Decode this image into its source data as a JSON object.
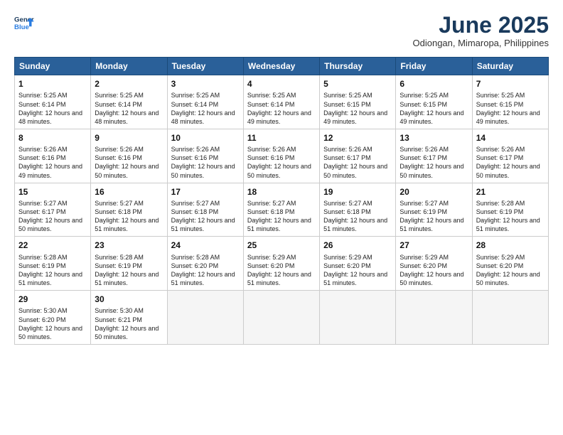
{
  "header": {
    "logo_line1": "General",
    "logo_line2": "Blue",
    "month_title": "June 2025",
    "location": "Odiongan, Mimaropa, Philippines"
  },
  "columns": [
    "Sunday",
    "Monday",
    "Tuesday",
    "Wednesday",
    "Thursday",
    "Friday",
    "Saturday"
  ],
  "rows": [
    [
      {
        "day": "1",
        "info": "Sunrise: 5:25 AM\nSunset: 6:14 PM\nDaylight: 12 hours\nand 48 minutes."
      },
      {
        "day": "2",
        "info": "Sunrise: 5:25 AM\nSunset: 6:14 PM\nDaylight: 12 hours\nand 48 minutes."
      },
      {
        "day": "3",
        "info": "Sunrise: 5:25 AM\nSunset: 6:14 PM\nDaylight: 12 hours\nand 48 minutes."
      },
      {
        "day": "4",
        "info": "Sunrise: 5:25 AM\nSunset: 6:14 PM\nDaylight: 12 hours\nand 49 minutes."
      },
      {
        "day": "5",
        "info": "Sunrise: 5:25 AM\nSunset: 6:15 PM\nDaylight: 12 hours\nand 49 minutes."
      },
      {
        "day": "6",
        "info": "Sunrise: 5:25 AM\nSunset: 6:15 PM\nDaylight: 12 hours\nand 49 minutes."
      },
      {
        "day": "7",
        "info": "Sunrise: 5:25 AM\nSunset: 6:15 PM\nDaylight: 12 hours\nand 49 minutes."
      }
    ],
    [
      {
        "day": "8",
        "info": "Sunrise: 5:26 AM\nSunset: 6:16 PM\nDaylight: 12 hours\nand 49 minutes."
      },
      {
        "day": "9",
        "info": "Sunrise: 5:26 AM\nSunset: 6:16 PM\nDaylight: 12 hours\nand 50 minutes."
      },
      {
        "day": "10",
        "info": "Sunrise: 5:26 AM\nSunset: 6:16 PM\nDaylight: 12 hours\nand 50 minutes."
      },
      {
        "day": "11",
        "info": "Sunrise: 5:26 AM\nSunset: 6:16 PM\nDaylight: 12 hours\nand 50 minutes."
      },
      {
        "day": "12",
        "info": "Sunrise: 5:26 AM\nSunset: 6:17 PM\nDaylight: 12 hours\nand 50 minutes."
      },
      {
        "day": "13",
        "info": "Sunrise: 5:26 AM\nSunset: 6:17 PM\nDaylight: 12 hours\nand 50 minutes."
      },
      {
        "day": "14",
        "info": "Sunrise: 5:26 AM\nSunset: 6:17 PM\nDaylight: 12 hours\nand 50 minutes."
      }
    ],
    [
      {
        "day": "15",
        "info": "Sunrise: 5:27 AM\nSunset: 6:17 PM\nDaylight: 12 hours\nand 50 minutes."
      },
      {
        "day": "16",
        "info": "Sunrise: 5:27 AM\nSunset: 6:18 PM\nDaylight: 12 hours\nand 51 minutes."
      },
      {
        "day": "17",
        "info": "Sunrise: 5:27 AM\nSunset: 6:18 PM\nDaylight: 12 hours\nand 51 minutes."
      },
      {
        "day": "18",
        "info": "Sunrise: 5:27 AM\nSunset: 6:18 PM\nDaylight: 12 hours\nand 51 minutes."
      },
      {
        "day": "19",
        "info": "Sunrise: 5:27 AM\nSunset: 6:18 PM\nDaylight: 12 hours\nand 51 minutes."
      },
      {
        "day": "20",
        "info": "Sunrise: 5:27 AM\nSunset: 6:19 PM\nDaylight: 12 hours\nand 51 minutes."
      },
      {
        "day": "21",
        "info": "Sunrise: 5:28 AM\nSunset: 6:19 PM\nDaylight: 12 hours\nand 51 minutes."
      }
    ],
    [
      {
        "day": "22",
        "info": "Sunrise: 5:28 AM\nSunset: 6:19 PM\nDaylight: 12 hours\nand 51 minutes."
      },
      {
        "day": "23",
        "info": "Sunrise: 5:28 AM\nSunset: 6:19 PM\nDaylight: 12 hours\nand 51 minutes."
      },
      {
        "day": "24",
        "info": "Sunrise: 5:28 AM\nSunset: 6:20 PM\nDaylight: 12 hours\nand 51 minutes."
      },
      {
        "day": "25",
        "info": "Sunrise: 5:29 AM\nSunset: 6:20 PM\nDaylight: 12 hours\nand 51 minutes."
      },
      {
        "day": "26",
        "info": "Sunrise: 5:29 AM\nSunset: 6:20 PM\nDaylight: 12 hours\nand 51 minutes."
      },
      {
        "day": "27",
        "info": "Sunrise: 5:29 AM\nSunset: 6:20 PM\nDaylight: 12 hours\nand 50 minutes."
      },
      {
        "day": "28",
        "info": "Sunrise: 5:29 AM\nSunset: 6:20 PM\nDaylight: 12 hours\nand 50 minutes."
      }
    ],
    [
      {
        "day": "29",
        "info": "Sunrise: 5:30 AM\nSunset: 6:20 PM\nDaylight: 12 hours\nand 50 minutes."
      },
      {
        "day": "30",
        "info": "Sunrise: 5:30 AM\nSunset: 6:21 PM\nDaylight: 12 hours\nand 50 minutes."
      },
      {
        "day": "",
        "info": ""
      },
      {
        "day": "",
        "info": ""
      },
      {
        "day": "",
        "info": ""
      },
      {
        "day": "",
        "info": ""
      },
      {
        "day": "",
        "info": ""
      }
    ]
  ]
}
